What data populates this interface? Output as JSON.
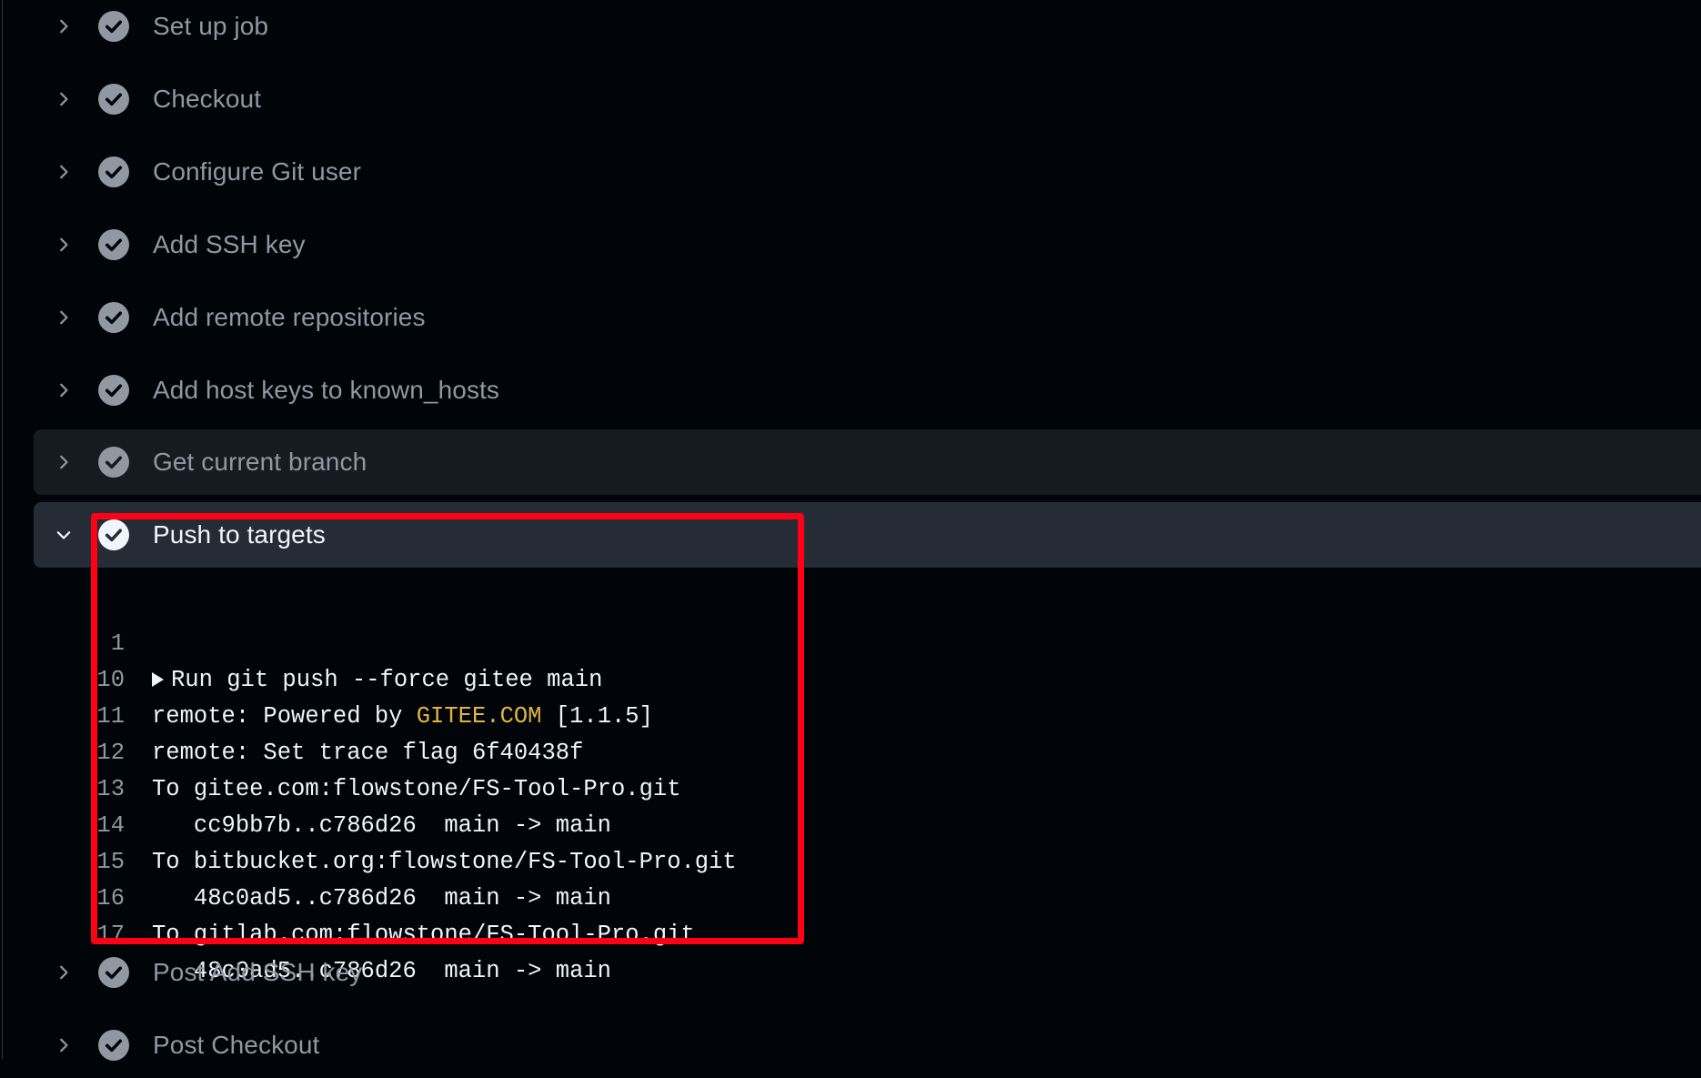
{
  "steps": [
    {
      "label": "Set up job",
      "state": "collapsed"
    },
    {
      "label": "Checkout",
      "state": "collapsed"
    },
    {
      "label": "Configure Git user",
      "state": "collapsed"
    },
    {
      "label": "Add SSH key",
      "state": "collapsed"
    },
    {
      "label": "Add remote repositories",
      "state": "collapsed"
    },
    {
      "label": "Add host keys to known_hosts",
      "state": "collapsed"
    },
    {
      "label": "Get current branch",
      "state": "collapsed-hover"
    },
    {
      "label": "Push to targets",
      "state": "expanded"
    },
    {
      "label": "Post Add SSH key",
      "state": "collapsed"
    },
    {
      "label": "Post Checkout",
      "state": "collapsed"
    }
  ],
  "log": {
    "lines": [
      {
        "num": "1",
        "text": "Run git push --force gitee main",
        "collapsible": true
      },
      {
        "num": "10",
        "pre": "remote: Powered by ",
        "highlight": "GITEE.COM",
        "post": " [1.1.5]"
      },
      {
        "num": "11",
        "text": "remote: Set trace flag 6f40438f"
      },
      {
        "num": "12",
        "text": "To gitee.com:flowstone/FS-Tool-Pro.git"
      },
      {
        "num": "13",
        "text": "   cc9bb7b..c786d26  main -> main"
      },
      {
        "num": "14",
        "text": "To bitbucket.org:flowstone/FS-Tool-Pro.git"
      },
      {
        "num": "15",
        "text": "   48c0ad5..c786d26  main -> main"
      },
      {
        "num": "16",
        "text": "To gitlab.com:flowstone/FS-Tool-Pro.git"
      },
      {
        "num": "17",
        "text": "   48c0ad5..c786d26  main -> main"
      }
    ]
  },
  "colors": {
    "background": "#010409",
    "check_done": "#9198a1",
    "check_active": "#f0f6fc",
    "annotation_box": "#ff0015",
    "log_highlight": "#e3b341"
  }
}
